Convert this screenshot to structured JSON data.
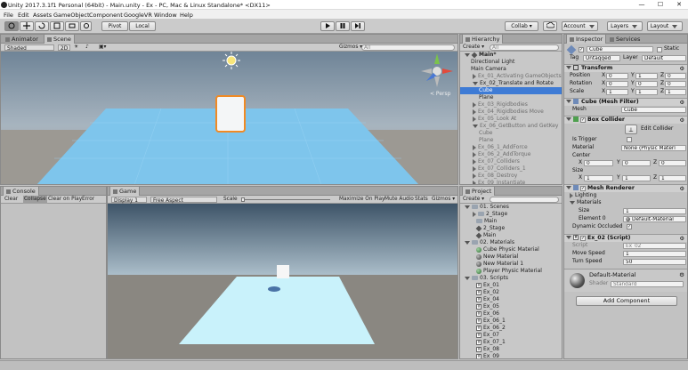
{
  "window": {
    "title": "Unity 2017.3.1f1 Personal (64bit) - Main.unity - Ex - PC, Mac & Linux Standalone* <DX11>",
    "minimize": "—",
    "maximize": "☐",
    "close": "✕"
  },
  "menu": [
    "File",
    "Edit",
    "Assets",
    "GameObject",
    "Component",
    "GoogleVR",
    "Window",
    "Help"
  ],
  "toolbar": {
    "pivot": "Pivot",
    "local": "Local",
    "collab": "Collab ▾",
    "account": "Account",
    "layers": "Layers",
    "layout": "Layout"
  },
  "scene": {
    "tabs": [
      "Animator",
      "Scene"
    ],
    "shaded": "Shaded",
    "mode2d": "2D",
    "gizmos": "Gizmos ▾",
    "search_placeholder": "All",
    "persp": "< Persp"
  },
  "game": {
    "tabs": [
      "Game"
    ],
    "display": "Display 1",
    "aspect": "Free Aspect",
    "scale_label": "Scale",
    "toggles": [
      "Maximize On Play",
      "Mute Audio",
      "Stats",
      "Gizmos ▾"
    ]
  },
  "console": {
    "tabs": [
      "Console"
    ],
    "buttons": [
      "Clear",
      "Collapse",
      "Clear on Play",
      "Error Pause"
    ]
  },
  "hierarchy": {
    "tab": "Hierarchy",
    "create": "Create ▾",
    "search_placeholder": "All",
    "items": [
      {
        "text": "Main*",
        "depth": 0,
        "arrow": true,
        "bold": true
      },
      {
        "text": "Directional Light",
        "depth": 1
      },
      {
        "text": "Main Camera",
        "depth": 1
      },
      {
        "text": "Ex_01_Activating GameObjects",
        "depth": 1,
        "arrow": "right",
        "dim": true
      },
      {
        "text": "Ex_02_Translate and Rotate",
        "depth": 1,
        "arrow": "down"
      },
      {
        "text": "Cube",
        "depth": 2,
        "selected": true
      },
      {
        "text": "Plane",
        "depth": 2
      },
      {
        "text": "Ex_03_Rigidbodies",
        "depth": 1,
        "arrow": "right",
        "dim": true
      },
      {
        "text": "Ex_04_Rigidbodies Move",
        "depth": 1,
        "arrow": "right",
        "dim": true
      },
      {
        "text": "Ex_05_Look At",
        "depth": 1,
        "arrow": "right",
        "dim": true
      },
      {
        "text": "Ex_06_GetButton and GetKey",
        "depth": 1,
        "arrow": "down",
        "dim": true
      },
      {
        "text": "Cube",
        "depth": 2,
        "dim": true
      },
      {
        "text": "Plane",
        "depth": 2,
        "dim": true
      },
      {
        "text": "Ex_06_1_AddForce",
        "depth": 1,
        "arrow": "right",
        "dim": true
      },
      {
        "text": "Ex_06_2_AddTorque",
        "depth": 1,
        "arrow": "right",
        "dim": true
      },
      {
        "text": "Ex_07_Colliders",
        "depth": 1,
        "arrow": "right",
        "dim": true
      },
      {
        "text": "Ex_07_Colliders_1",
        "depth": 1,
        "arrow": "right",
        "dim": true
      },
      {
        "text": "Ex_08_Destroy",
        "depth": 1,
        "arrow": "right",
        "dim": true
      },
      {
        "text": "Ex_09_Instantiate",
        "depth": 1,
        "arrow": "right",
        "dim": true
      }
    ]
  },
  "project": {
    "tab": "Project",
    "create": "Create ▾",
    "items": [
      {
        "text": "01. Scenes",
        "depth": 0,
        "icon": "folder",
        "arrow": "down"
      },
      {
        "text": "2_Stage",
        "depth": 1,
        "icon": "folder",
        "arrow": "right"
      },
      {
        "text": "Main",
        "depth": 1,
        "icon": "folder"
      },
      {
        "text": "2_Stage",
        "depth": 1,
        "icon": "unity"
      },
      {
        "text": "Main",
        "depth": 1,
        "icon": "unity"
      },
      {
        "text": "02. Materials",
        "depth": 0,
        "icon": "folder",
        "arrow": "down"
      },
      {
        "text": "Cube Physic Material",
        "depth": 1,
        "icon": "phys"
      },
      {
        "text": "New Material",
        "depth": 1,
        "icon": "sphere"
      },
      {
        "text": "New Material 1",
        "depth": 1,
        "icon": "sphere"
      },
      {
        "text": "Player Physic Material",
        "depth": 1,
        "icon": "phys"
      },
      {
        "text": "03. Scripts",
        "depth": 0,
        "icon": "folder",
        "arrow": "down"
      },
      {
        "text": "Ex_01",
        "depth": 1,
        "icon": "cs"
      },
      {
        "text": "Ex_02",
        "depth": 1,
        "icon": "cs"
      },
      {
        "text": "Ex_04",
        "depth": 1,
        "icon": "cs"
      },
      {
        "text": "Ex_05",
        "depth": 1,
        "icon": "cs"
      },
      {
        "text": "Ex_06",
        "depth": 1,
        "icon": "cs"
      },
      {
        "text": "Ex_06_1",
        "depth": 1,
        "icon": "cs"
      },
      {
        "text": "Ex_06_2",
        "depth": 1,
        "icon": "cs"
      },
      {
        "text": "Ex_07",
        "depth": 1,
        "icon": "cs"
      },
      {
        "text": "Ex_07_1",
        "depth": 1,
        "icon": "cs"
      },
      {
        "text": "Ex_08",
        "depth": 1,
        "icon": "cs"
      },
      {
        "text": "Ex_09",
        "depth": 1,
        "icon": "cs"
      }
    ]
  },
  "inspector": {
    "tabs": [
      "Inspector",
      "Services"
    ],
    "object": {
      "name": "Cube",
      "static": "Static",
      "tag_label": "Tag",
      "tag": "Untagged",
      "layer_label": "Layer",
      "layer": "Default"
    },
    "transform": {
      "title": "Transform",
      "position": {
        "label": "Position",
        "x": "0",
        "y": "1",
        "z": "0"
      },
      "rotation": {
        "label": "Rotation",
        "x": "0",
        "y": "0",
        "z": "0"
      },
      "scale": {
        "label": "Scale",
        "x": "1",
        "y": "1",
        "z": "1"
      }
    },
    "meshfilter": {
      "title": "Cube (Mesh Filter)",
      "mesh_label": "Mesh",
      "mesh": "Cube"
    },
    "boxcollider": {
      "title": "Box Collider",
      "edit": "Edit Collider",
      "trigger": "Is Trigger",
      "material_label": "Material",
      "material": "None (Physic Materi",
      "center": "Center",
      "size": "Size",
      "cx": "0",
      "cy": "0",
      "cz": "0",
      "sx": "1",
      "sy": "1",
      "sz": "1"
    },
    "meshrenderer": {
      "title": "Mesh Renderer",
      "lighting": "Lighting",
      "materials": "Materials",
      "size_label": "Size",
      "size": "1",
      "element_label": "Element 0",
      "element": "Default-Material",
      "occluded": "Dynamic Occluded"
    },
    "script": {
      "title": "Ex_02 (Script)",
      "script_label": "Script",
      "script": "Ex_02",
      "move_label": "Move Speed",
      "move": "1",
      "turn_label": "Turn Speed",
      "turn": "50"
    },
    "material": {
      "name": "Default-Material",
      "shader_label": "Shader",
      "shader": "Standard"
    },
    "add_component": "Add Component"
  },
  "colors": {
    "accent": "#3e7bd5",
    "selection_orange": "#f08a24",
    "plane_blue": "#7cc2ea",
    "game_plane": "#c9f2fb"
  }
}
